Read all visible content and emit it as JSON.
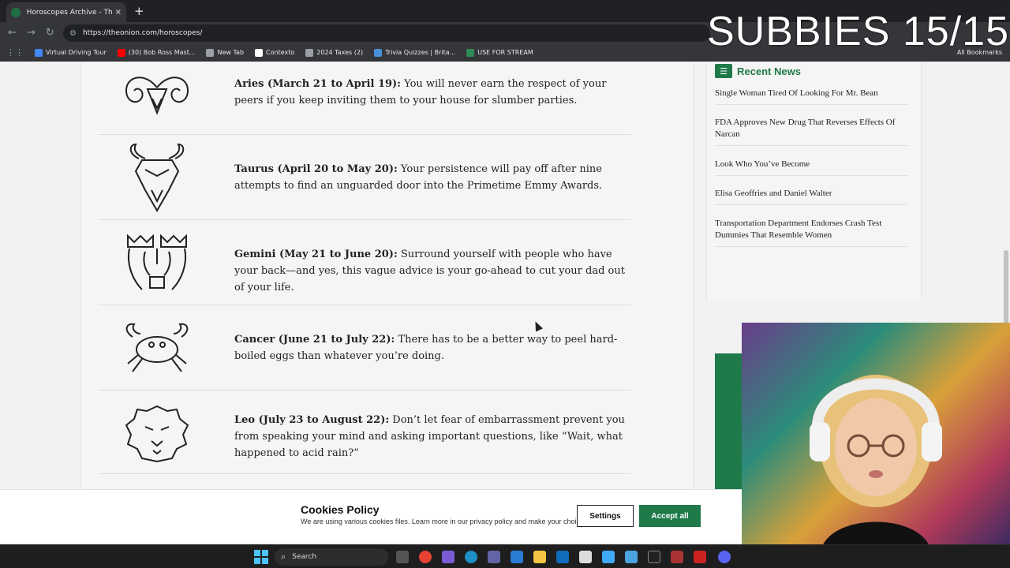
{
  "browser": {
    "tab_title": "Horoscopes Archive - The Onion",
    "tab_close": "×",
    "new_tab": "+",
    "url": "https://theonion.com/horoscopes/",
    "bookmarks": [
      {
        "label": "Virtual Driving Tour",
        "color": "#4285f4"
      },
      {
        "label": "(30) Bob Ross Mast...",
        "color": "#ff0000"
      },
      {
        "label": "New Tab",
        "color": "#9aa0a6"
      },
      {
        "label": "Contexto",
        "color": "#ffffff"
      },
      {
        "label": "2024 Taxes (2)",
        "color": "#9aa0a6"
      },
      {
        "label": "Trivia Quizzes | Brita...",
        "color": "#4a90d9"
      },
      {
        "label": "USE FOR STREAM",
        "color": "#2e8b57"
      }
    ],
    "all_bookmarks": "All Bookmarks"
  },
  "overlay": {
    "text": "SUBBIES 15/15"
  },
  "horoscopes": [
    {
      "icon": "aries-ram-icon",
      "title": "Aries (March 21 to April 19):",
      "text": " You will never earn the respect of your peers if you keep inviting them to your house for slumber parties."
    },
    {
      "icon": "taurus-bull-icon",
      "title": "Taurus (April 20 to May 20):",
      "text": " Your persistence will pay off after nine attempts to find an unguarded door into the Primetime Emmy Awards."
    },
    {
      "icon": "gemini-twins-icon",
      "title": "Gemini (May 21 to June 20):",
      "text": " Surround yourself with people who have your back—and yes, this vague advice is your go-ahead to cut your dad out of your life."
    },
    {
      "icon": "cancer-crab-icon",
      "title": "Cancer (June 21 to July 22):",
      "text": " There has to be a better way to peel hard-boiled eggs than whatever you’re doing."
    },
    {
      "icon": "leo-lion-icon",
      "title": "Leo (July 23 to August 22):",
      "text": " Don’t let fear of embarrassment prevent you from speaking your mind and asking important questions, like “Wait, what happened to acid rain?”"
    }
  ],
  "sidebar": {
    "title": "Recent News",
    "items": [
      "Single Woman Tired Of Looking For Mr. Bean",
      "FDA Approves New Drug That Reverses Effects Of Narcan",
      "Look Who You’ve Become",
      "Elisa Geoffries and Daniel Walter",
      "Transportation Department Endorses Crash Test Dummies That Resemble Women"
    ]
  },
  "cookie": {
    "title": "Cookies Policy",
    "description": "We are using various cookies files. Learn more in our privacy policy and make your choice.",
    "settings_label": "Settings",
    "accept_label": "Accept all"
  },
  "taskbar": {
    "search_label": "Search"
  }
}
